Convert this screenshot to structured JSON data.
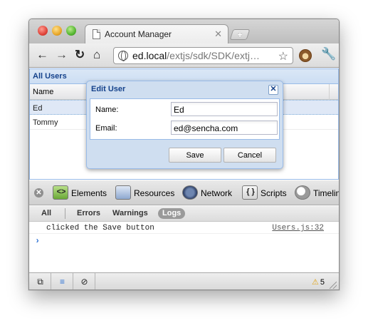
{
  "browser": {
    "tab_title": "Account Manager",
    "tab_close": "✕",
    "new_tab": "+",
    "url_host": "ed.local",
    "url_path": "/extjs/sdk/SDK/extj…"
  },
  "grid": {
    "title": "All Users",
    "columns": [
      "Name"
    ],
    "rows": [
      {
        "name": "Ed",
        "selected": true
      },
      {
        "name": "Tommy",
        "selected": false
      }
    ]
  },
  "dialog": {
    "title": "Edit User",
    "close": "✕",
    "fields": [
      {
        "label": "Name:",
        "value": "Ed"
      },
      {
        "label": "Email:",
        "value": "ed@sencha.com"
      }
    ],
    "save_label": "Save",
    "cancel_label": "Cancel"
  },
  "devtools": {
    "panels": [
      "Elements",
      "Resources",
      "Network",
      "Scripts",
      "Timeline"
    ],
    "filters": [
      "All",
      "Errors",
      "Warnings",
      "Logs"
    ],
    "active_filter": "Logs",
    "log": {
      "message": "clicked the Save button",
      "source": "Users.js:32"
    },
    "prompt": "›",
    "warning_count": "5"
  }
}
